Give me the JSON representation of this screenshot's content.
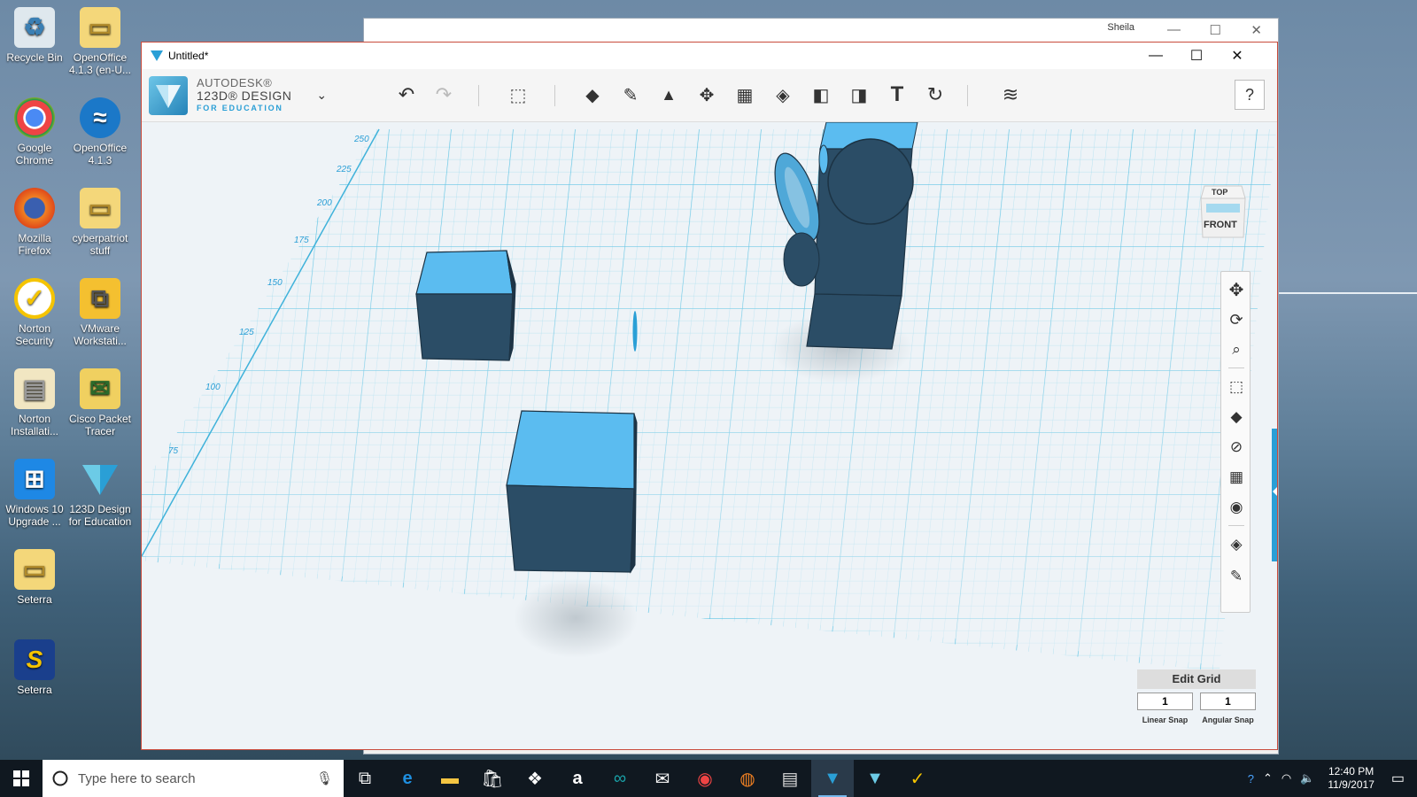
{
  "desktop": {
    "icons": [
      {
        "label": "Recycle Bin",
        "icon": "recycle-bin-icon"
      },
      {
        "label": "OpenOffice 4.1.3 (en-U...",
        "icon": "folder-icon"
      },
      {
        "label": "Google Chrome",
        "icon": "chrome-icon"
      },
      {
        "label": "OpenOffice 4.1.3",
        "icon": "openoffice-icon"
      },
      {
        "label": "Mozilla Firefox",
        "icon": "firefox-icon"
      },
      {
        "label": "cyberpatriot stuff",
        "icon": "folder-icon"
      },
      {
        "label": "Norton Security",
        "icon": "norton-icon"
      },
      {
        "label": "VMware Workstati...",
        "icon": "vmware-icon"
      },
      {
        "label": "Norton Installati...",
        "icon": "norton-installer-icon"
      },
      {
        "label": "Cisco Packet Tracer",
        "icon": "packet-tracer-icon"
      },
      {
        "label": "Windows 10 Upgrade ...",
        "icon": "windows-icon"
      },
      {
        "label": "123D Design for Education",
        "icon": "123d-icon"
      },
      {
        "label": "Seterra",
        "icon": "folder-icon"
      },
      {
        "label": "Seterra",
        "icon": "seterra-icon"
      }
    ]
  },
  "background_window": {
    "user": "Sheila"
  },
  "app": {
    "title": "Untitled*",
    "brand": {
      "line1": "AUTODESK®",
      "line2": "123D® DESIGN",
      "line3": "FOR EDUCATION"
    },
    "toolbar": [
      {
        "name": "undo-icon",
        "glyph": "↶"
      },
      {
        "name": "redo-icon",
        "glyph": "↷"
      },
      {
        "name": "transform-icon",
        "glyph": "⬚"
      },
      {
        "name": "primitives-icon",
        "glyph": "◆"
      },
      {
        "name": "sketch-icon",
        "glyph": "✎"
      },
      {
        "name": "construct-icon",
        "glyph": "▲"
      },
      {
        "name": "modify-icon",
        "glyph": "✥"
      },
      {
        "name": "pattern-icon",
        "glyph": "▦"
      },
      {
        "name": "grouping-icon",
        "glyph": "◈"
      },
      {
        "name": "combine-icon",
        "glyph": "◧"
      },
      {
        "name": "measure-icon",
        "glyph": "◨"
      },
      {
        "name": "text-icon",
        "glyph": "T"
      },
      {
        "name": "snap-icon",
        "glyph": "↻"
      },
      {
        "name": "materials-icon",
        "glyph": "≋"
      }
    ],
    "help_label": "?",
    "viewcube": {
      "top": "TOP",
      "front": "FRONT"
    },
    "ruler_labels": [
      "250",
      "225",
      "200",
      "175",
      "150",
      "125",
      "100",
      "75"
    ],
    "edit_grid": {
      "title": "Edit Grid",
      "linear_value": "1",
      "angular_value": "1",
      "linear_label": "Linear Snap",
      "angular_label": "Angular Snap"
    },
    "nav_tools": [
      "pan-icon",
      "orbit-icon",
      "zoom-icon",
      "fit-icon",
      "view-cube-icon",
      "visibility-icon",
      "materials-view-icon",
      "camera-icon",
      "solids-icon",
      "sketches-icon"
    ]
  },
  "taskbar": {
    "search_placeholder": "Type here to search",
    "apps": [
      "task-view-icon",
      "edge-icon",
      "file-explorer-icon",
      "store-icon",
      "dropbox-icon",
      "amazon-icon",
      "arduino-icon",
      "mail-icon",
      "chrome-icon",
      "firefox-icon",
      "notepad-icon",
      "123d-design-icon",
      "123d-make-icon",
      "norton-icon"
    ],
    "time": "12:40 PM",
    "date": "11/9/2017"
  },
  "colors": {
    "accent": "#2a9fd6",
    "solid_top": "#5bbcf0",
    "solid_side": "#2b4d66",
    "grid": "#6ccbe6"
  }
}
